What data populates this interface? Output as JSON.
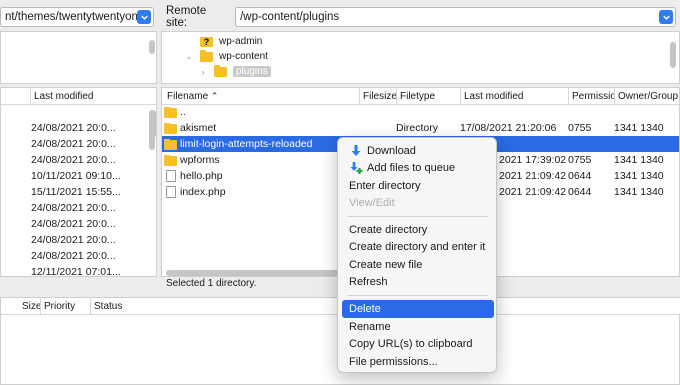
{
  "local": {
    "path_value": "nt/themes/twentytwentyone/",
    "columns": {
      "last_modified": "Last modified"
    },
    "rows": [
      "24/08/2021 20:0...",
      "24/08/2021 20:0...",
      "24/08/2021 20:0...",
      "10/11/2021 09:10...",
      "15/11/2021 15:55...",
      "24/08/2021 20:0...",
      "24/08/2021 20:0...",
      "24/08/2021 20:0...",
      "24/08/2021 20:0...",
      "12/11/2021 07:01..."
    ]
  },
  "remote": {
    "site_label": "Remote site:",
    "path_value": "/wp-content/plugins",
    "tree": [
      {
        "label": "wp-admin",
        "icon": "question-folder-icon"
      },
      {
        "label": "wp-content",
        "icon": "folder-icon",
        "chevron": "⌄"
      },
      {
        "label": "plugins",
        "icon": "folder-icon",
        "chevron": "›"
      }
    ],
    "columns": {
      "filename": "Filename",
      "filesize": "Filesize",
      "filetype": "Filetype",
      "last_modified": "Last modified",
      "permissions": "Permissio",
      "owner_group": "Owner/Group"
    },
    "files": [
      {
        "name": "..",
        "type": "",
        "modified": "",
        "perms": "",
        "owner": "",
        "icon": "folder"
      },
      {
        "name": "akismet",
        "type": "Directory",
        "modified": "17/08/2021 21:20:06",
        "perms": "0755",
        "owner": "1341 1340",
        "icon": "folder"
      },
      {
        "name": "limit-login-attempts-reloaded",
        "type": "",
        "modified": "",
        "perms": "",
        "owner": "",
        "icon": "folder",
        "selected": true
      },
      {
        "name": "wpforms",
        "type": "",
        "modified": "2021 17:39:02",
        "perms": "0755",
        "owner": "1341 1340",
        "icon": "folder"
      },
      {
        "name": "hello.php",
        "type": "",
        "modified": "2021 21:09:42",
        "perms": "0644",
        "owner": "1341 1340",
        "icon": "file"
      },
      {
        "name": "index.php",
        "type": "",
        "modified": "2021 21:09:42",
        "perms": "0644",
        "owner": "1341 1340",
        "icon": "file"
      }
    ],
    "status": "Selected 1 directory."
  },
  "queue": {
    "columns": {
      "size": "Size",
      "priority": "Priority",
      "status": "Status"
    }
  },
  "context_menu": {
    "items": [
      {
        "label": "Download",
        "icon": "download-arrow-icon"
      },
      {
        "label": "Add files to queue",
        "icon": "add-to-queue-icon"
      },
      {
        "label": "Enter directory"
      },
      {
        "label": "View/Edit",
        "disabled": true
      },
      {
        "label": "Create directory"
      },
      {
        "label": "Create directory and enter it"
      },
      {
        "label": "Create new file"
      },
      {
        "label": "Refresh"
      },
      {
        "label": "Delete",
        "highlighted": true
      },
      {
        "label": "Rename"
      },
      {
        "label": "Copy URL(s) to clipboard"
      },
      {
        "label": "File permissions..."
      }
    ]
  },
  "colors": {
    "accent": "#2a6ae3",
    "folder": "#f5c02a",
    "dropdown": "#2f7cf6"
  }
}
